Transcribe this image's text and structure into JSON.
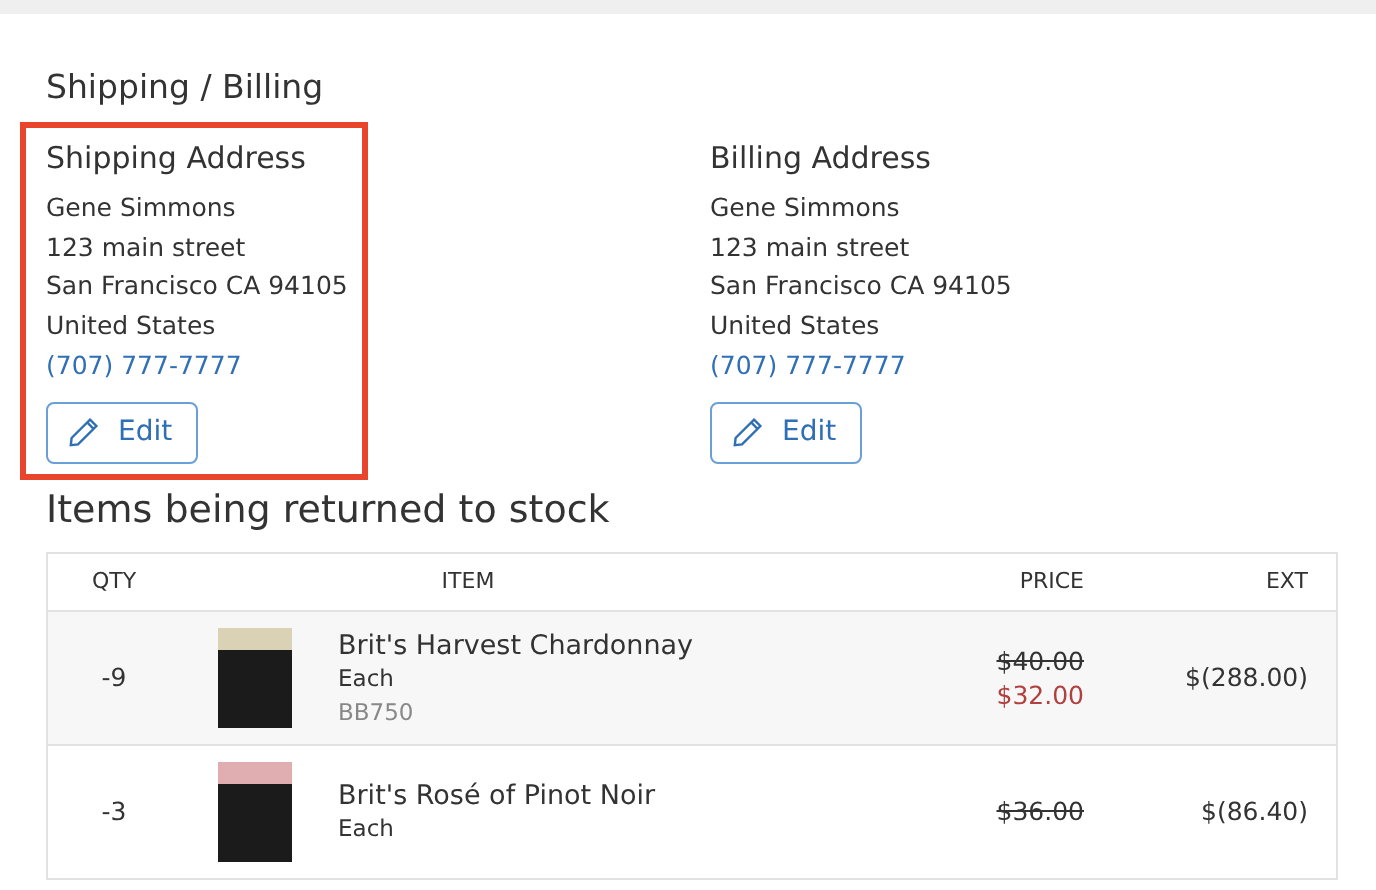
{
  "heading": "Shipping / Billing",
  "addresses": [
    {
      "title": "Shipping Address",
      "highlighted": true,
      "lines": [
        "Gene Simmons",
        "123 main street",
        "San Francisco CA 94105",
        "United States"
      ],
      "phone": "(707) 777-7777",
      "button": "Edit"
    },
    {
      "title": "Billing Address",
      "highlighted": false,
      "lines": [
        "Gene Simmons",
        "123 main street",
        "San Francisco CA 94105",
        "United States"
      ],
      "phone": "(707) 777-7777",
      "button": "Edit"
    }
  ],
  "items_heading": "Items being returned to stock",
  "table": {
    "columns": [
      "QTY",
      "ITEM",
      "PRICE",
      "EXT"
    ],
    "rows": [
      {
        "qty": "-9",
        "name": "Brit's Harvest Chardonnay",
        "unit": "Each",
        "sku": "BB750",
        "original_price": "$40.00",
        "price_struck": true,
        "sale_price": "$32.00",
        "ext": "$(288.00)"
      },
      {
        "qty": "-3",
        "name": "Brit's Rosé of Pinot Noir",
        "unit": "Each",
        "original_price": "$36.00",
        "price_struck": true,
        "ext": "$(86.40)"
      }
    ]
  }
}
